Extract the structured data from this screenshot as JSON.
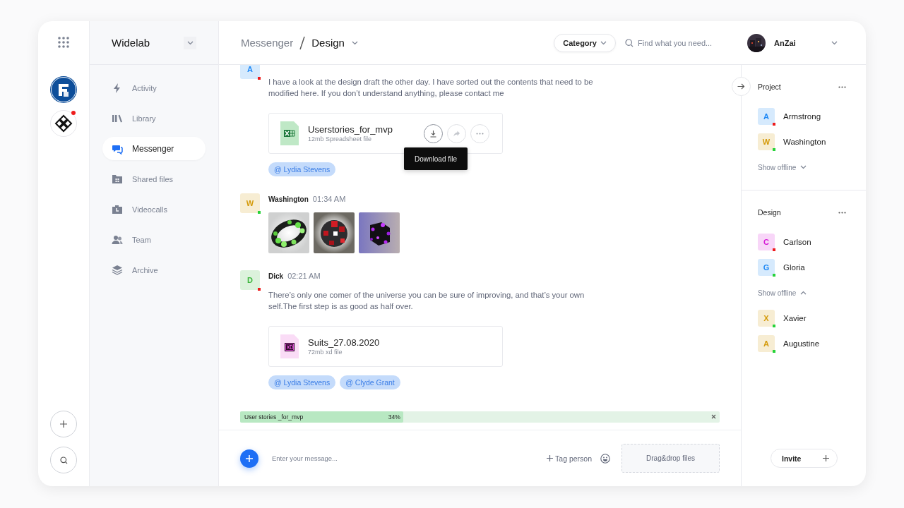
{
  "rail": {
    "workspaces": [
      {
        "kind": "ring",
        "notification": false
      },
      {
        "kind": "knot",
        "notification": true
      }
    ]
  },
  "sidebar": {
    "title": "Widelab",
    "items": [
      {
        "label": "Activity",
        "kind": "activity",
        "selected": false
      },
      {
        "label": "Library",
        "kind": "library",
        "selected": false
      },
      {
        "label": "Messenger",
        "kind": "messenger",
        "selected": true
      },
      {
        "label": "Shared files",
        "kind": "files",
        "selected": false
      },
      {
        "label": "Videocalls",
        "kind": "videocalls",
        "selected": false
      },
      {
        "label": "Team",
        "kind": "team",
        "selected": false
      },
      {
        "label": "Archive",
        "kind": "archive",
        "selected": false
      }
    ]
  },
  "header": {
    "breadcrumb": [
      "Messenger",
      "Design"
    ],
    "category": "Category",
    "search": {
      "placeholder": "Find what you need..."
    },
    "user": {
      "name": "AnZai"
    }
  },
  "messages": [
    {
      "avatar": "A",
      "color": "#1e88f5",
      "online": false,
      "text": "I have a look at the design draft the other day. I have sorted out the contents that need to be modified here. If you don’t understand anything, please contact me",
      "attachment": {
        "kind": "spreadsheet",
        "name": "Userstories_for_mvp",
        "meta": "12mb Spreadsheet file",
        "actions": true,
        "tooltip": "Download file"
      },
      "mentions": [
        "@ Lydia Stevens"
      ]
    },
    {
      "avatar": "W",
      "color": "#d49a0a",
      "online": true,
      "author": "Washington",
      "time": "01:34 AM"
    },
    {
      "avatar": "D",
      "color": "#3bb53b",
      "online": false,
      "author": "Dick",
      "time": "02:21 AM",
      "text": "There’s only one comer of the universe you can be sure of improving, and that’s your own self.The first step is as good as half over.",
      "attachment": {
        "kind": "xd",
        "name": "Suits_27.08.2020",
        "meta": "72mb xd file",
        "actions": false
      },
      "mentions": [
        "@ Lydia Stevens",
        "@ Clyde Grant"
      ]
    }
  ],
  "upload": {
    "name": "User stories _for_mvp",
    "percent": "34%",
    "level": 0.34
  },
  "composer": {
    "placeholder": "Enter your message...",
    "tag": "Tag person",
    "dropzone": "Drag&drop files"
  },
  "groups": [
    {
      "title": "Project",
      "members": [
        {
          "avatar": "A",
          "name": "Armstrong",
          "color": "#1e88f5",
          "online": false
        },
        {
          "avatar": "W",
          "name": "Washington",
          "color": "#d49a0a",
          "online": true
        }
      ],
      "toggle": {
        "label": "Show offline",
        "expanded": false
      }
    },
    {
      "title": "Design",
      "members": [
        {
          "avatar": "C",
          "name": "Carlson",
          "color": "#d61ad6",
          "online": false
        },
        {
          "avatar": "G",
          "name": "Gloria",
          "color": "#1e88f5",
          "online": true
        }
      ],
      "toggle": {
        "label": "Show offline",
        "expanded": true
      },
      "offline": [
        {
          "avatar": "X",
          "name": "Xavier",
          "color": "#d49a0a",
          "online": true
        },
        {
          "avatar": "A",
          "name": "Augustine",
          "color": "#d49a0a",
          "online": true
        }
      ]
    }
  ],
  "invite": "Invite"
}
